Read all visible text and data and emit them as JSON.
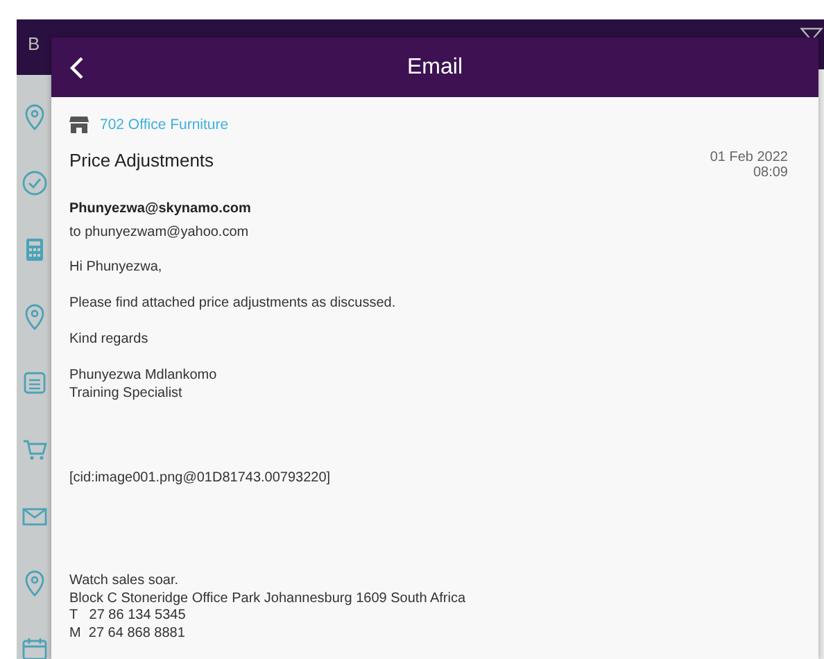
{
  "background": {
    "back_label": "B"
  },
  "email": {
    "title": "Email",
    "account": "702 Office Furniture",
    "subject": "Price Adjustments",
    "date": "01 Feb 2022",
    "time": "08:09",
    "from": "Phunyezwa@skynamo.com",
    "to": "to phunyezwam@yahoo.com",
    "body": [
      {
        "kind": "text",
        "lines": [
          "Hi Phunyezwa,"
        ]
      },
      {
        "kind": "text",
        "lines": [
          "Please find attached price adjustments as discussed."
        ]
      },
      {
        "kind": "text",
        "lines": [
          "Kind regards"
        ]
      },
      {
        "kind": "text",
        "lines": [
          "Phunyezwa Mdlankomo",
          "Training Specialist"
        ]
      },
      {
        "kind": "image-ref",
        "lines": [
          "[cid:image001.png@01D81743.00793220]"
        ]
      },
      {
        "kind": "text",
        "lines": [
          "Watch sales soar.",
          "Block C Stoneridge Office Park Johannesburg 1609 South Africa",
          "T   27 86 134 5345",
          "M  27 64 868 8881"
        ]
      }
    ]
  }
}
